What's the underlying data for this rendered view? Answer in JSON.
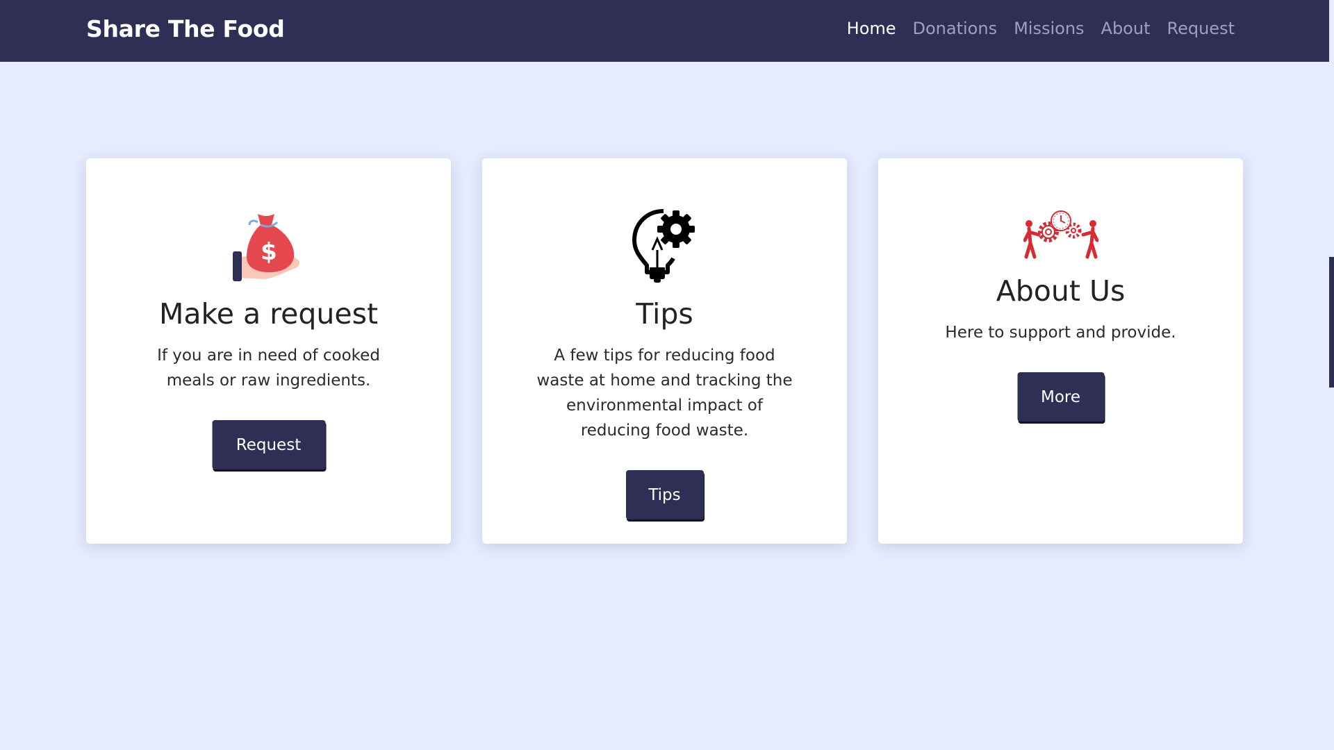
{
  "navbar": {
    "brand": "Share The Food",
    "links": [
      {
        "label": "Home",
        "active": true
      },
      {
        "label": "Donations",
        "active": false
      },
      {
        "label": "Missions",
        "active": false
      },
      {
        "label": "About",
        "active": false
      },
      {
        "label": "Request",
        "active": false
      }
    ]
  },
  "cards": [
    {
      "icon": "money-bag-hand-icon",
      "title": "Make a request",
      "text": "If you are in need of cooked meals or raw ingredients.",
      "button": "Request"
    },
    {
      "icon": "lightbulb-gear-icon",
      "title": "Tips",
      "text": "A few tips for reducing food waste at home and tracking the environmental impact of reducing food waste.",
      "button": "Tips"
    },
    {
      "icon": "teamwork-gears-icon",
      "title": "About Us",
      "text": "Here to support and provide.",
      "button": "More"
    }
  ],
  "colors": {
    "navbar_bg": "#2f2e55",
    "page_bg": "#e6ebfe",
    "card_bg": "#ffffff",
    "button_bg": "#2f2e55",
    "icon_red": "#d72a33",
    "nav_inactive": "#9ea0bd"
  }
}
